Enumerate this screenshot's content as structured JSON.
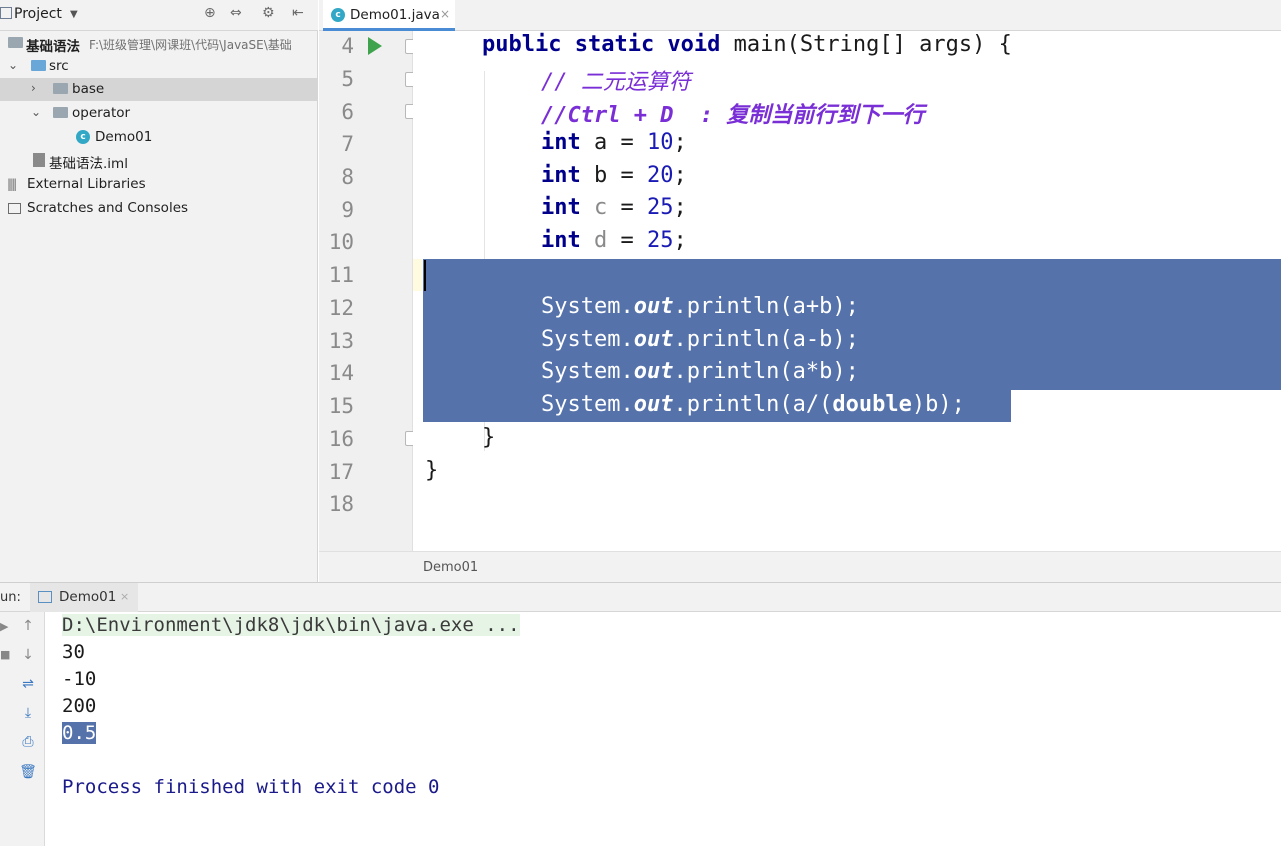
{
  "project_panel": {
    "title": "Project",
    "tree": [
      {
        "label": "基础语法",
        "hint": "F:\\班级管理\\网课班\\代码\\JavaSE\\基础"
      },
      {
        "label": "src"
      },
      {
        "label": "base"
      },
      {
        "label": "operator"
      },
      {
        "label": "Demo01"
      },
      {
        "label": "基础语法.iml"
      },
      {
        "label": "External Libraries"
      },
      {
        "label": "Scratches and Consoles"
      }
    ]
  },
  "editor": {
    "tab": {
      "label": "Demo01.java",
      "close": "×"
    },
    "line_numbers": [
      "4",
      "5",
      "6",
      "7",
      "8",
      "9",
      "10",
      "11",
      "12",
      "13",
      "14",
      "15",
      "16",
      "17",
      "18"
    ],
    "code": {
      "l4": {
        "kw": "public static void",
        "rest": " main(String[] args) {"
      },
      "l5": "// 二元运算符",
      "l6": "//Ctrl + D  : 复制当前行到下一行",
      "int_kw": "int",
      "l7": {
        "name": " a = ",
        "val": "10",
        "end": ";"
      },
      "l8": {
        "name": " b = ",
        "val": "20",
        "end": ";"
      },
      "l9": {
        "name": "c",
        "val": "25",
        "end": ";"
      },
      "l10": {
        "name": "d",
        "val": "25",
        "end": ";"
      },
      "sys": "System.",
      "out": "out",
      "l12": ".println(a+b);",
      "l13": ".println(a-b);",
      "l14": ".println(a*b);",
      "l15_a": ".println(a/(",
      "l15_kw": "double",
      "l15_b": ")b);",
      "l16": "}",
      "l17": "}"
    },
    "breadcrumb": "Demo01"
  },
  "run_panel": {
    "label": "un:",
    "tab": {
      "label": "Demo01",
      "close": "×"
    },
    "console": {
      "command": "D:\\Environment\\jdk8\\jdk\\bin\\java.exe ...",
      "outputs": [
        "30",
        "-10",
        "200",
        "0.5"
      ],
      "exit": "Process finished with exit code 0"
    }
  },
  "colors": {
    "selection": "#5572aa",
    "keyword": "#00008b",
    "comment": "#7a2fd6",
    "number": "#1a1ab5",
    "run_icon": "#3fa34d"
  }
}
